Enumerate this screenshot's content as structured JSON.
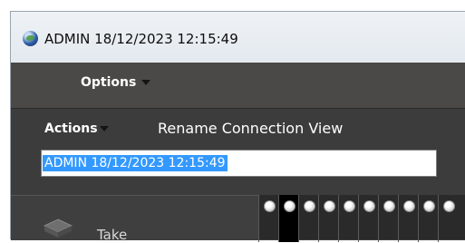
{
  "window": {
    "title": "ADMIN 18/12/2023 12:15:49",
    "icon": "globe-icon"
  },
  "menubar": {
    "options_label": "Options"
  },
  "panel": {
    "actions_label": "Actions",
    "rename_label": "Rename Connection View",
    "name_input_value": "ADMIN  18/12/2023 12:15:49"
  },
  "lower": {
    "take_label": "Take",
    "slot_count": 10,
    "active_slot": 2
  },
  "colors": {
    "selection": "#3399ff",
    "panel_bg": "#3d3c3c",
    "titlebar_bg": "#e9edf2"
  }
}
